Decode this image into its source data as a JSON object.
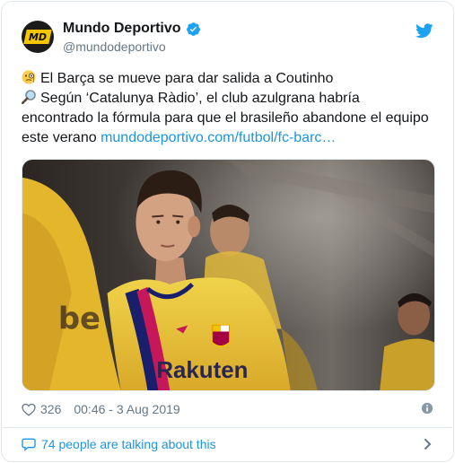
{
  "tweet": {
    "author": {
      "display_name": "Mundo Deportivo",
      "handle": "@mundodeportivo",
      "avatar_text": "MD",
      "verified": true
    },
    "text": {
      "line1": "El Barça se mueve para dar salida a Coutinho",
      "line2": "Según ‘Catalunya Ràdio’, el club azulgrana habría",
      "line3": "encontrado la fórmula para que el brasileño abandone el equipo",
      "line4_text": "este verano",
      "link": "mundodeportivo.com/futbol/fc-barc…"
    },
    "media": {
      "jersey_text": "Rakuten",
      "left_jersey_text": "be"
    },
    "likes": "326",
    "timestamp": "00:46 - 3 Aug 2019",
    "conversation": "74 people are talking about this"
  },
  "icons": {
    "verified": "verified-badge-icon",
    "bird": "twitter-bird-icon",
    "emoji1": "monocle-face-emoji",
    "emoji2": "magnifying-glass-emoji",
    "heart": "heart-icon",
    "info": "info-icon",
    "bubble": "speech-bubble-icon",
    "chevron": "chevron-right-icon"
  },
  "colors": {
    "accent": "#1b95e0",
    "text": "#14171a",
    "muted": "#657786",
    "border": "#e1e8ed"
  }
}
